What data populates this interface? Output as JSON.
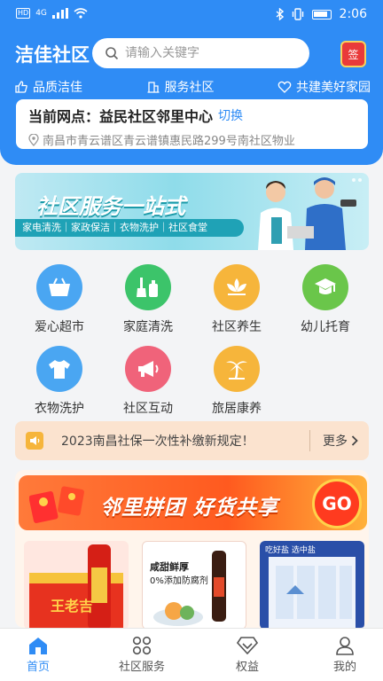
{
  "status_bar": {
    "time": "2:06",
    "hd": "HD",
    "network": "4G"
  },
  "header": {
    "brand": "洁佳社区",
    "search_placeholder": "请输入关键字",
    "signin_label": "签"
  },
  "slogans": [
    "品质洁佳",
    "服务社区",
    "共建美好家园"
  ],
  "site": {
    "prefix": "当前网点：",
    "name": "益民社区邻里中心",
    "switch_label": "切换",
    "address": "南昌市青云谱区青云谱镇惠民路299号南社区物业"
  },
  "banner": {
    "title": "社区服务一站式",
    "subtitle": "家电清洗｜家政保洁｜衣物洗护｜社区食堂"
  },
  "services": [
    {
      "label": "爱心超市",
      "icon": "basket-icon",
      "color": "#4aa6f2"
    },
    {
      "label": "家庭清洗",
      "icon": "cleaning-icon",
      "color": "#3cc46a"
    },
    {
      "label": "社区养生",
      "icon": "lotus-icon",
      "color": "#f6b53b"
    },
    {
      "label": "幼儿托育",
      "icon": "graduation-cap-icon",
      "color": "#6ac64a"
    },
    {
      "label": "衣物洗护",
      "icon": "shirt-icon",
      "color": "#4aa6f2"
    },
    {
      "label": "社区互动",
      "icon": "megaphone-icon",
      "color": "#f0637a"
    },
    {
      "label": "旅居康养",
      "icon": "palm-tree-icon",
      "color": "#f6b53b"
    }
  ],
  "notice": {
    "text": "2023南昌社保一次性补缴新规定！",
    "more_label": "更多"
  },
  "group_buy": {
    "title": "邻里拼团 好货共享",
    "go_label": "GO",
    "product1_brand": "王老吉",
    "product2_text1": "咸甜鲜厚",
    "product2_text2": "0%添加防腐剂",
    "product3_tag": "吃好盐 选中盐"
  },
  "tabbar": [
    {
      "label": "首页",
      "icon": "home-icon",
      "active": true
    },
    {
      "label": "社区服务",
      "icon": "grid-icon",
      "active": false
    },
    {
      "label": "权益",
      "icon": "diamond-icon",
      "active": false
    },
    {
      "label": "我的",
      "icon": "user-icon",
      "active": false
    }
  ]
}
